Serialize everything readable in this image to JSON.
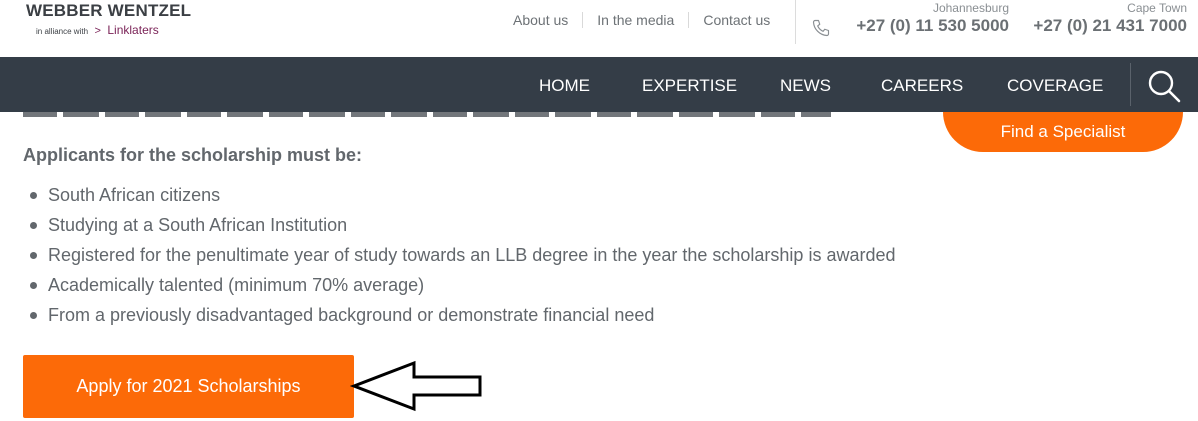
{
  "brand": {
    "name": "WEBBER WENTZEL",
    "alliance_text": "in alliance with",
    "partner_chevron": ">",
    "partner": "Linklaters"
  },
  "top_links": [
    "About us",
    "In the media",
    "Contact us"
  ],
  "offices": [
    {
      "city": "Johannesburg",
      "phone": "+27 (0) 11 530 5000"
    },
    {
      "city": "Cape Town",
      "phone": "+27 (0) 21 431 7000"
    }
  ],
  "nav": {
    "items": [
      "HOME",
      "EXPERTISE",
      "NEWS",
      "CAREERS",
      "COVERAGE"
    ],
    "search_icon": "search-icon"
  },
  "specialist_button": "Find a Specialist",
  "content": {
    "heading": "Applicants for the scholarship must be:",
    "requirements": [
      "South African citizens",
      "Studying at a South African Institution",
      "Registered for the penultimate year of study towards an LLB degree in the year the scholarship is awarded",
      "Academically talented (minimum 70% average)",
      "From a previously disadvantaged background or demonstrate financial need"
    ],
    "apply_button": "Apply for 2021 Scholarships"
  },
  "icons": {
    "phone": "phone-icon",
    "search": "search-icon",
    "annotation_arrow": "left-arrow-icon"
  },
  "colors": {
    "accent_orange": "#fc6a08",
    "nav_background": "#343d47",
    "partner_purple": "#7b2458",
    "body_text": "#62676c"
  }
}
